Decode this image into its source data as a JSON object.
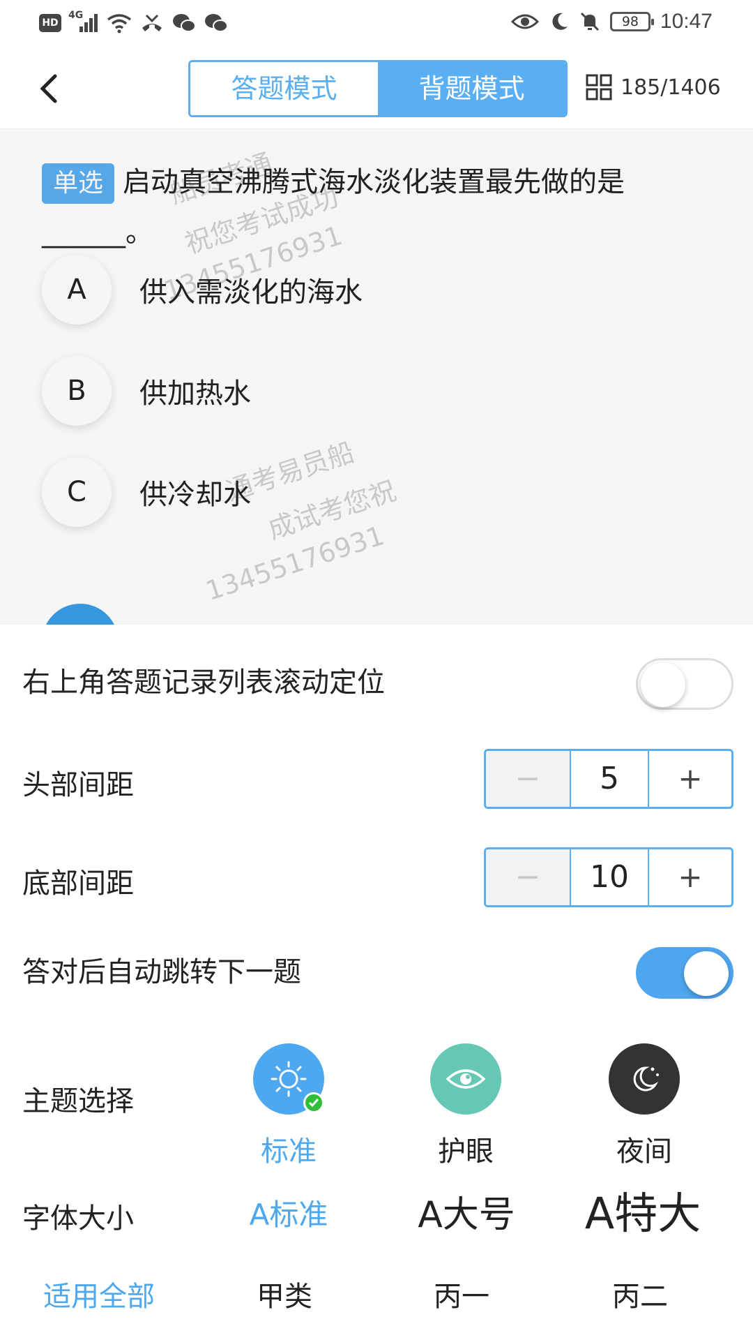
{
  "status_bar": {
    "hd_badge": "HD",
    "network": "4G",
    "battery": "98",
    "time": "10:47",
    "icons": [
      "hd-icon",
      "signal-icon",
      "wifi-icon",
      "missed-call-icon",
      "wechat-icon",
      "wechat-icon",
      "eye-icon",
      "moon-icon",
      "mute-icon",
      "battery-icon"
    ]
  },
  "header": {
    "back_icon": "chevron-left-icon",
    "tab_answer": "答题模式",
    "tab_recite": "背题模式",
    "active_tab": "背题模式",
    "grid_icon": "grid-icon",
    "progress": "185/1406"
  },
  "question": {
    "tag": "单选",
    "text": "启动真空沸腾式海水淡化装置最先做的是______。",
    "options": [
      {
        "letter": "A",
        "text": "供入需淡化的海水"
      },
      {
        "letter": "B",
        "text": "供加热水"
      },
      {
        "letter": "C",
        "text": "供冷却水"
      }
    ]
  },
  "watermarks": {
    "a": "船员考通",
    "b": "祝您考试成功",
    "c": "13455176931",
    "d": "通考易员船",
    "e": "成试考您祝",
    "f": "13455176931"
  },
  "settings": {
    "scroll_locate_label": "右上角答题记录列表滚动定位",
    "scroll_locate_on": false,
    "top_spacing_label": "头部间距",
    "top_spacing_value": "5",
    "bottom_spacing_label": "底部间距",
    "bottom_spacing_value": "10",
    "minus": "−",
    "plus": "+",
    "auto_next_label": "答对后自动跳转下一题",
    "auto_next_on": true,
    "theme_label": "主题选择",
    "themes": [
      {
        "name": "标准",
        "icon": "sun-icon",
        "color": "#4da8f0",
        "selected": true
      },
      {
        "name": "护眼",
        "icon": "eye-icon",
        "color": "#66c8b4",
        "selected": false
      },
      {
        "name": "夜间",
        "icon": "moon-stars-icon",
        "color": "#333333",
        "selected": false
      }
    ],
    "font_size_label": "字体大小",
    "font_sizes": [
      {
        "label": "A标准",
        "selected": true
      },
      {
        "label": "A大号",
        "selected": false
      },
      {
        "label": "A特大",
        "selected": false
      }
    ],
    "apply_all": "适用全部",
    "categories": [
      "甲类",
      "丙一",
      "丙二"
    ]
  },
  "colors": {
    "accent": "#5aaef2",
    "toggle_on": "#4fa6f0",
    "check_green": "#2fbf3a"
  }
}
